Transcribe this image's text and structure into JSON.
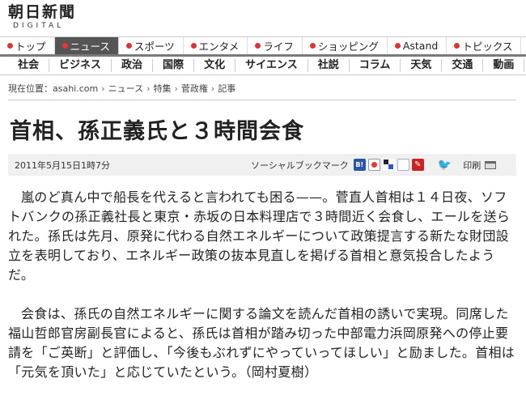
{
  "logo": {
    "main": "朝日新聞",
    "sub": "DIGITAL"
  },
  "main_nav": [
    {
      "label": "トップ",
      "name": "nav-top"
    },
    {
      "label": "ニュース",
      "name": "nav-news",
      "active": true
    },
    {
      "label": "スポーツ",
      "name": "nav-sports"
    },
    {
      "label": "エンタメ",
      "name": "nav-entame"
    },
    {
      "label": "ライフ",
      "name": "nav-life"
    },
    {
      "label": "ショッピング",
      "name": "nav-shopping"
    },
    {
      "label": "Astand",
      "name": "nav-astand"
    },
    {
      "label": "トピックス",
      "name": "nav-topics"
    }
  ],
  "sub_nav": [
    "社会",
    "ビジネス",
    "政治",
    "国際",
    "文化",
    "サイエンス",
    "社説",
    "コラム",
    "天気",
    "交通",
    "動画"
  ],
  "breadcrumb": {
    "prefix": "現在位置：",
    "items": [
      "asahi.com",
      "ニュース",
      "特集",
      "菅政権",
      "記事"
    ]
  },
  "article": {
    "title": "首相、孫正義氏と３時間会食",
    "date": "2011年5月15日1時7分",
    "social_label": "ソーシャルブックマーク",
    "print_label": "印刷",
    "paragraphs": [
      "嵐のど真ん中で船長を代えると言われても困る——。菅直人首相は１４日夜、ソフトバンクの孫正義社長と東京・赤坂の日本料理店で３時間近く会食し、エールを送られた。孫氏は先月、原発に代わる自然エネルギーについて政策提言する新たな財団設立を表明しており、エネルギー政策の抜本見直しを掲げる首相と意気投合したようだ。",
      "会食は、孫氏の自然エネルギーに関する論文を読んだ首相の誘いで実現。同席した福山哲郎官房副長官によると、孫氏は首相が踏み切った中部電力浜岡原発への停止要請を「ご英断」と評価し、「今後もぶれずにやっていってほしい」と励ました。首相は「元気を頂いた」と応じていたという。（岡村夏樹）"
    ]
  },
  "colors": {
    "active_nav": "#555555",
    "accent_dot": "#dd3333",
    "meta_bar": "#f0f0f0"
  }
}
